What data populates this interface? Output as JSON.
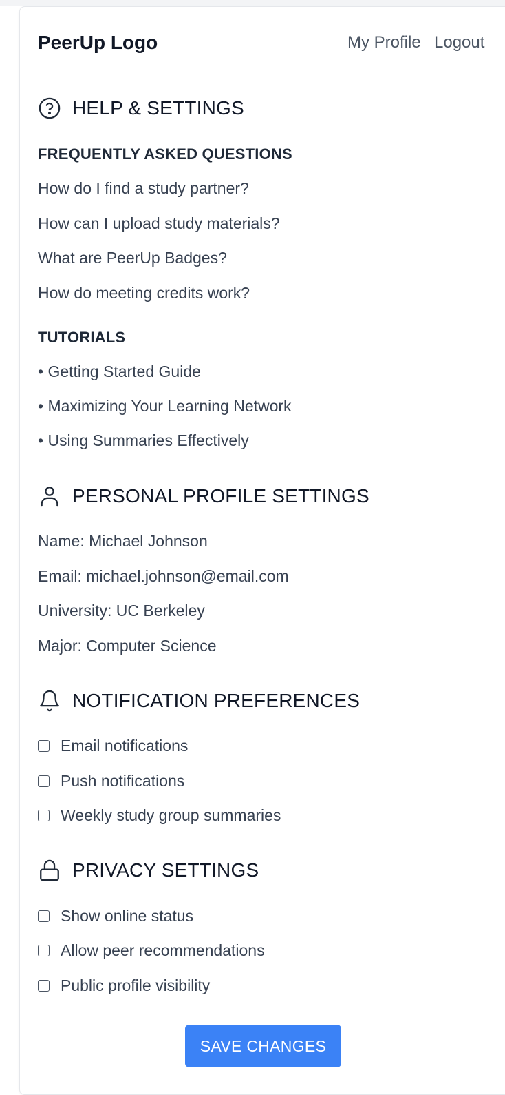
{
  "header": {
    "logo": "PeerUp Logo",
    "nav": {
      "my_profile": "My Profile",
      "logout": "Logout"
    }
  },
  "help": {
    "title": "HELP & SETTINGS",
    "icon": "question-circle-icon",
    "faq_heading": "FREQUENTLY ASKED QUESTIONS",
    "faqs": [
      "How do I find a study partner?",
      "How can I upload study materials?",
      "What are PeerUp Badges?",
      "How do meeting credits work?"
    ],
    "tutorials_heading": "TUTORIALS",
    "tutorials": [
      "• Getting Started Guide",
      "• Maximizing Your Learning Network",
      "• Using Summaries Effectively"
    ]
  },
  "profile": {
    "title": "PERSONAL PROFILE SETTINGS",
    "icon": "user-icon",
    "fields": [
      "Name: Michael Johnson",
      "Email: michael.johnson@email.com",
      "University: UC Berkeley",
      "Major: Computer Science"
    ]
  },
  "notifications": {
    "title": "NOTIFICATION PREFERENCES",
    "icon": "bell-icon",
    "options": [
      {
        "label": "Email notifications",
        "checked": false
      },
      {
        "label": "Push notifications",
        "checked": false
      },
      {
        "label": "Weekly study group summaries",
        "checked": false
      }
    ]
  },
  "privacy": {
    "title": "PRIVACY SETTINGS",
    "icon": "lock-icon",
    "options": [
      {
        "label": "Show online status",
        "checked": false
      },
      {
        "label": "Allow peer recommendations",
        "checked": false
      },
      {
        "label": "Public profile visibility",
        "checked": false
      }
    ]
  },
  "save_button": "SAVE CHANGES",
  "colors": {
    "accent": "#3b82f6",
    "text": "#374151",
    "heading": "#111827",
    "border": "#e5e7eb"
  }
}
